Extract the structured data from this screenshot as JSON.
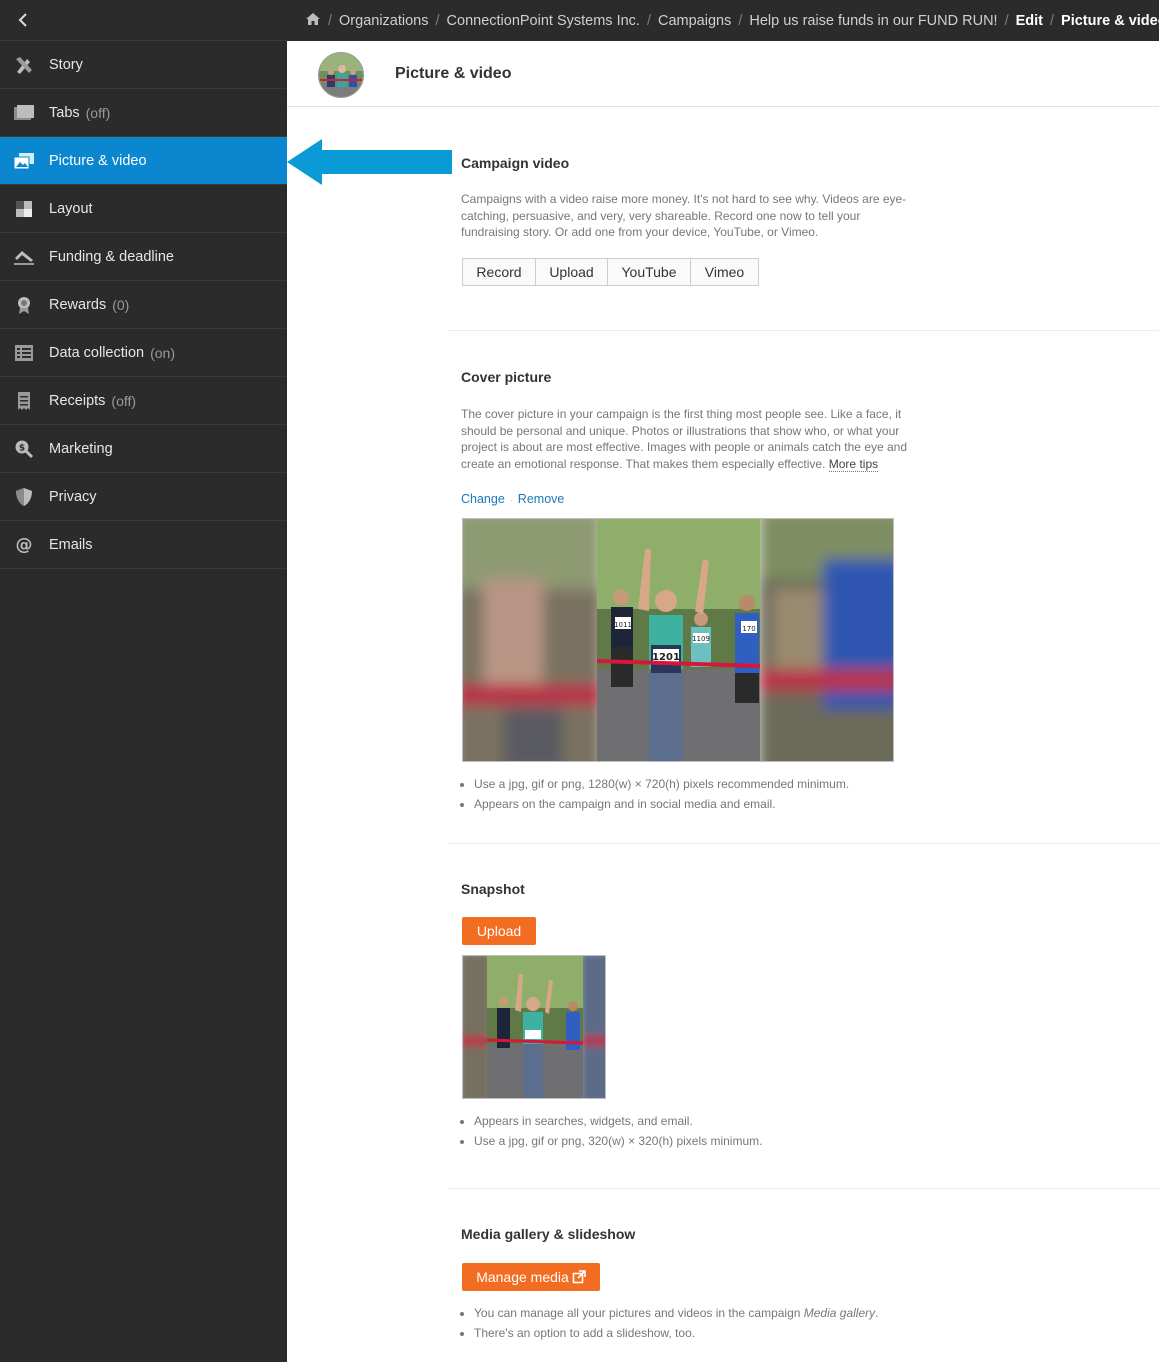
{
  "sidebar": {
    "back_icon": "chevron-left-icon",
    "items": [
      {
        "label": "Story",
        "suffix": "",
        "icon": "pencil-ruler-icon"
      },
      {
        "label": "Tabs",
        "suffix": "(off)",
        "icon": "folder-icon"
      },
      {
        "label": "Picture & video",
        "suffix": "",
        "icon": "pictures-icon"
      },
      {
        "label": "Layout",
        "suffix": "",
        "icon": "layout-icon"
      },
      {
        "label": "Funding & deadline",
        "suffix": "",
        "icon": "funding-icon"
      },
      {
        "label": "Rewards",
        "suffix": "(0)",
        "icon": "award-icon"
      },
      {
        "label": "Data collection",
        "suffix": "(on)",
        "icon": "list-icon"
      },
      {
        "label": "Receipts",
        "suffix": "(off)",
        "icon": "receipt-icon"
      },
      {
        "label": "Marketing",
        "suffix": "",
        "icon": "search-dollar-icon"
      },
      {
        "label": "Privacy",
        "suffix": "",
        "icon": "shield-icon"
      },
      {
        "label": "Emails",
        "suffix": "",
        "icon": "at-icon"
      }
    ],
    "active_index": 2,
    "active_color": "#0a87cf"
  },
  "breadcrumb": {
    "home_icon": "home-icon",
    "items": [
      "Organizations",
      "ConnectionPoint Systems Inc.",
      "Campaigns",
      "Help us raise funds in our FUND RUN!"
    ],
    "edit": "Edit",
    "current": "Picture & video"
  },
  "header": {
    "title": "Picture & video"
  },
  "video": {
    "title": "Campaign video",
    "description": "Campaigns with a video raise more money. It's not hard to see why. Videos are eye-catching, persuasive, and very, very shareable. Record one now to tell your fundraising story. Or add one from your device, YouTube, or Vimeo.",
    "buttons": [
      "Record",
      "Upload",
      "YouTube",
      "Vimeo"
    ]
  },
  "cover": {
    "title": "Cover picture",
    "description": "The cover picture in your campaign is the first thing most people see. Like a face, it should be personal and unique. Photos or illustrations that show who, or what your project is about are most effective. Images with people or animals catch the eye and create an emotional response. That makes them especially effective.",
    "more_tips": "More tips",
    "change": "Change",
    "remove": "Remove",
    "bib_main": "1201",
    "bib_left": "1011",
    "bib_mid": "1109",
    "bib_right": "170",
    "bullets": [
      "Use a jpg, gif or png, 1280(w) × 720(h) pixels recommended minimum.",
      "Appears on the campaign and in social media and email."
    ]
  },
  "snapshot": {
    "title": "Snapshot",
    "upload": "Upload",
    "bullets": [
      "Appears in searches, widgets, and email.",
      "Use a jpg, gif or png, 320(w) × 320(h) pixels minimum."
    ]
  },
  "gallery": {
    "title": "Media gallery & slideshow",
    "manage": "Manage media",
    "external_icon": "external-link-icon",
    "bullet1_pre": "You can manage all your pictures and videos in the campaign ",
    "bullet1_em": "Media gallery",
    "bullet1_post": ".",
    "bullet2": "There's an option to add a slideshow, too."
  },
  "colors": {
    "accent_orange": "#f26d21",
    "link_blue": "#1b7ab8",
    "arrow_blue": "#0a9bd6"
  }
}
